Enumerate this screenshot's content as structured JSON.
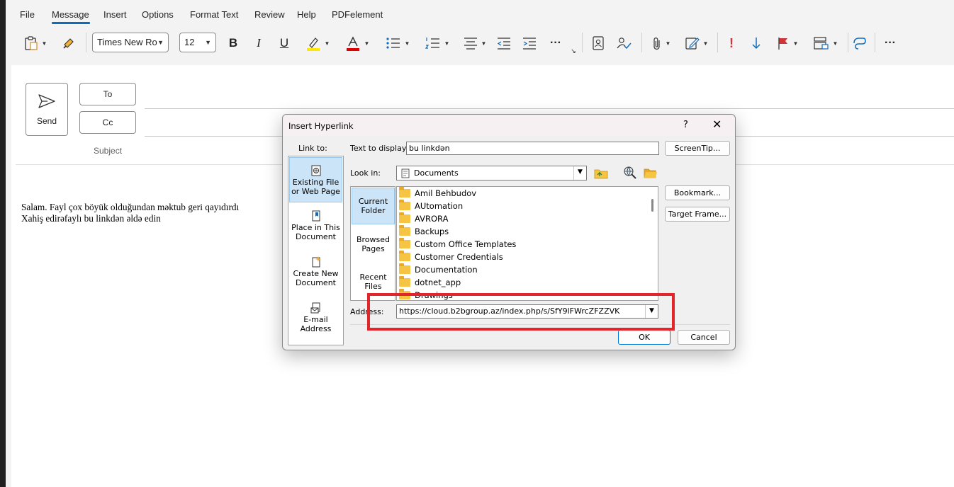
{
  "menu": {
    "file": "File",
    "message": "Message",
    "insert": "Insert",
    "options": "Options",
    "format_text": "Format Text",
    "review": "Review",
    "help": "Help",
    "pdfelement": "PDFelement"
  },
  "ribbon": {
    "font_name": "Times New Ro",
    "font_size": "12",
    "more": "···",
    "more2": "···"
  },
  "compose": {
    "send_label": "Send",
    "to_label": "To",
    "cc_label": "Cc",
    "subject_label": "Subject",
    "body_line1": "Salam. Fayl çox böyük olduğundan məktub geri qayıdırdı",
    "body_line2": "Xahiş edirəfaylı bu linkdən əldə edin"
  },
  "dialog": {
    "title": "Insert Hyperlink",
    "help": "?",
    "close": "✕",
    "link_to_label": "Link to:",
    "link_to_items": [
      {
        "line1": "Existing File",
        "line2": "or Web Page"
      },
      {
        "line1": "Place in This",
        "line2": "Document"
      },
      {
        "line1": "Create New",
        "line2": "Document"
      },
      {
        "line1": "E-mail",
        "line2": "Address"
      }
    ],
    "text_to_display_label": "Text to display:",
    "text_to_display_value": "bu linkdən",
    "screentip_button": "ScreenTip...",
    "look_in_label": "Look in:",
    "look_in_value": "Documents",
    "nav_items": [
      {
        "line1": "Current",
        "line2": "Folder"
      },
      {
        "line1": "Browsed",
        "line2": "Pages"
      },
      {
        "line1": "Recent",
        "line2": "Files"
      }
    ],
    "files": [
      "Amil Behbudov",
      "AUtomation",
      "AVRORA",
      "Backups",
      "Custom Office Templates",
      "Customer Credentials",
      "Documentation",
      "dotnet_app",
      "Drawings"
    ],
    "bookmark_button": "Bookmark...",
    "target_frame_button": "Target Frame...",
    "address_label": "Address:",
    "address_value": "https://cloud.b2bgroup.az/index.php/s/SfY9lFWrcZFZZVK",
    "ok_button": "OK",
    "cancel_button": "Cancel"
  },
  "colors": {
    "accent": "#0f6cbd",
    "highlight_box": "#e3242b",
    "selection": "#cce4f7"
  }
}
